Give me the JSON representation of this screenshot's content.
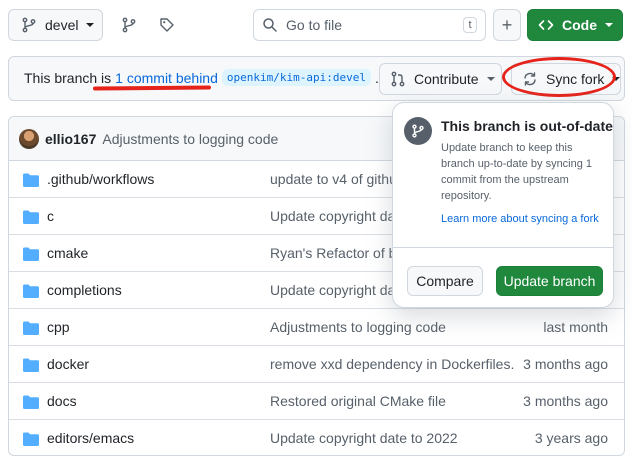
{
  "topbar": {
    "branch_label": "devel",
    "goto_placeholder": "Go to file",
    "goto_shortcut": "t",
    "add_label": "+",
    "code_label": "Code"
  },
  "sync_bar": {
    "prefix": "This branch is",
    "behind_link": "1 commit behind",
    "upstream_ref": "openkim/kim-api:devel",
    "suffix": ".",
    "contribute_label": "Contribute",
    "sync_label": "Sync fork"
  },
  "commit": {
    "author": "ellio167",
    "message": "Adjustments to logging code"
  },
  "files": [
    {
      "name": ".github/workflows",
      "message": "update to v4 of github",
      "date": ""
    },
    {
      "name": "c",
      "message": "Update copyright date",
      "date": ""
    },
    {
      "name": "cmake",
      "message": "Ryan's Refactor of bas",
      "date": ""
    },
    {
      "name": "completions",
      "message": "Update copyright date",
      "date": ""
    },
    {
      "name": "cpp",
      "message": "Adjustments to logging code",
      "date": "last month"
    },
    {
      "name": "docker",
      "message": "remove xxd dependency in Dockerfiles.",
      "date": "3 months ago"
    },
    {
      "name": "docs",
      "message": "Restored original CMake file",
      "date": "3 months ago"
    },
    {
      "name": "editors/emacs",
      "message": "Update copyright date to 2022",
      "date": "3 years ago"
    }
  ],
  "popover": {
    "title": "This branch is out-of-date",
    "description": "Update branch to keep this branch up-to-date by syncing 1 commit from the upstream repository.",
    "link": "Learn more about syncing a fork",
    "compare_label": "Compare",
    "update_label": "Update branch"
  },
  "colors": {
    "primary_green": "#1f883d",
    "link_blue": "#0969da",
    "folder_blue": "#54aeff",
    "annotation_red": "#e5231b"
  }
}
